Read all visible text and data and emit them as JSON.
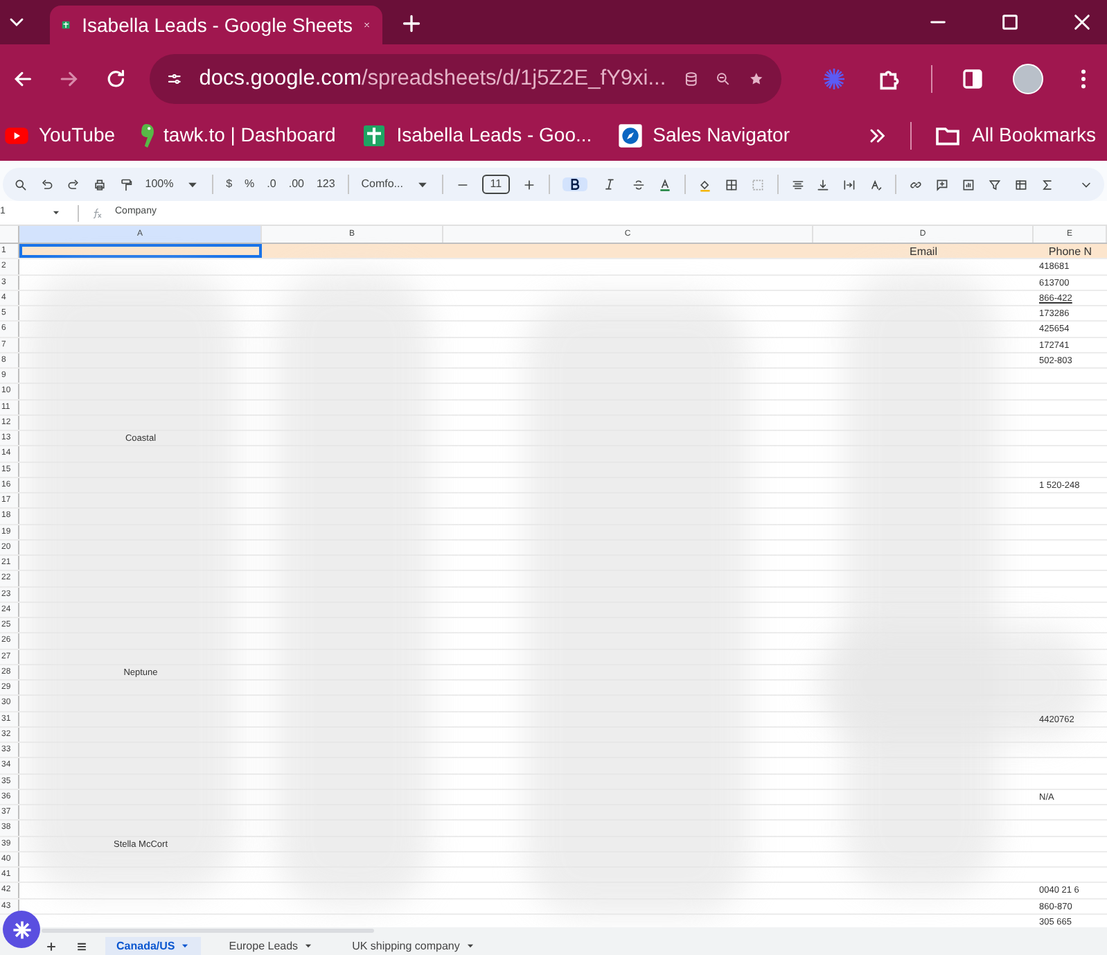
{
  "browser": {
    "tabs": [
      {
        "title": "Isabella Leads - Google Sheets",
        "selected": true
      }
    ],
    "url": {
      "host": "docs.google.com",
      "path": "/spreadsheets/d/1j5Z2E_fY9xi..."
    },
    "bookmarks": [
      {
        "kind": "youtube",
        "label": "YouTube"
      },
      {
        "kind": "tawk",
        "label": "tawk.to | Dashboard"
      },
      {
        "kind": "sheets",
        "label": "Isabella Leads - Goo..."
      },
      {
        "kind": "compass",
        "label": "Sales Navigator"
      }
    ],
    "all_bookmarks": "All Bookmarks"
  },
  "toolbar": {
    "zoom": "100%",
    "currency": "$",
    "percent": "%",
    "decrease_decimals": ".0",
    "increase_decimals": ".00",
    "number_format": "123",
    "font": "Comfo...",
    "font_size": "11",
    "bold": true,
    "italic": false
  },
  "formula_bar": {
    "cell_ref": "1",
    "content": "Company"
  },
  "sheet": {
    "columns": [
      {
        "label": "A",
        "selected": true
      },
      {
        "label": "B",
        "selected": false
      },
      {
        "label": "C",
        "selected": false
      },
      {
        "label": "D",
        "selected": false
      },
      {
        "label": "E",
        "selected": false
      }
    ],
    "header_row": {
      "number": "1",
      "column_d": "Email",
      "column_e": "Phone N"
    },
    "rows": [
      {
        "number": "2",
        "e": "418681"
      },
      {
        "number": "3",
        "e": "613700"
      },
      {
        "number": "4",
        "e": "866-422",
        "link": true
      },
      {
        "number": "5",
        "e": "173286"
      },
      {
        "number": "6",
        "e": "425654"
      },
      {
        "number": "7",
        "e": "172741"
      },
      {
        "number": "8",
        "e": "502-803"
      },
      {
        "number": "9"
      },
      {
        "number": "10"
      },
      {
        "number": "11"
      },
      {
        "number": "12"
      },
      {
        "number": "13",
        "a": "Coastal"
      },
      {
        "number": "14"
      },
      {
        "number": "15"
      },
      {
        "number": "16",
        "e": "1 520-248"
      },
      {
        "number": "17"
      },
      {
        "number": "18"
      },
      {
        "number": "19"
      },
      {
        "number": "20"
      },
      {
        "number": "21"
      },
      {
        "number": "22"
      },
      {
        "number": "23"
      },
      {
        "number": "24"
      },
      {
        "number": "25"
      },
      {
        "number": "26"
      },
      {
        "number": "27"
      },
      {
        "number": "28",
        "a": "Neptune"
      },
      {
        "number": "29"
      },
      {
        "number": "30"
      },
      {
        "number": "31",
        "e": "4420762"
      },
      {
        "number": "32"
      },
      {
        "number": "33"
      },
      {
        "number": "34"
      },
      {
        "number": "35"
      },
      {
        "number": "36",
        "e": "N/A"
      },
      {
        "number": "37"
      },
      {
        "number": "38"
      },
      {
        "number": "39",
        "a": "Stella McCort"
      },
      {
        "number": "40"
      },
      {
        "number": "41"
      },
      {
        "number": "42",
        "e": "0040 21 6"
      },
      {
        "number": "43",
        "e": "860-870"
      },
      {
        "e": "305 665"
      }
    ]
  },
  "sheet_tabs": [
    {
      "label": "Canada/US",
      "selected": true
    },
    {
      "label": "Europe Leads",
      "selected": false
    },
    {
      "label": "UK shipping company",
      "selected": false
    }
  ]
}
